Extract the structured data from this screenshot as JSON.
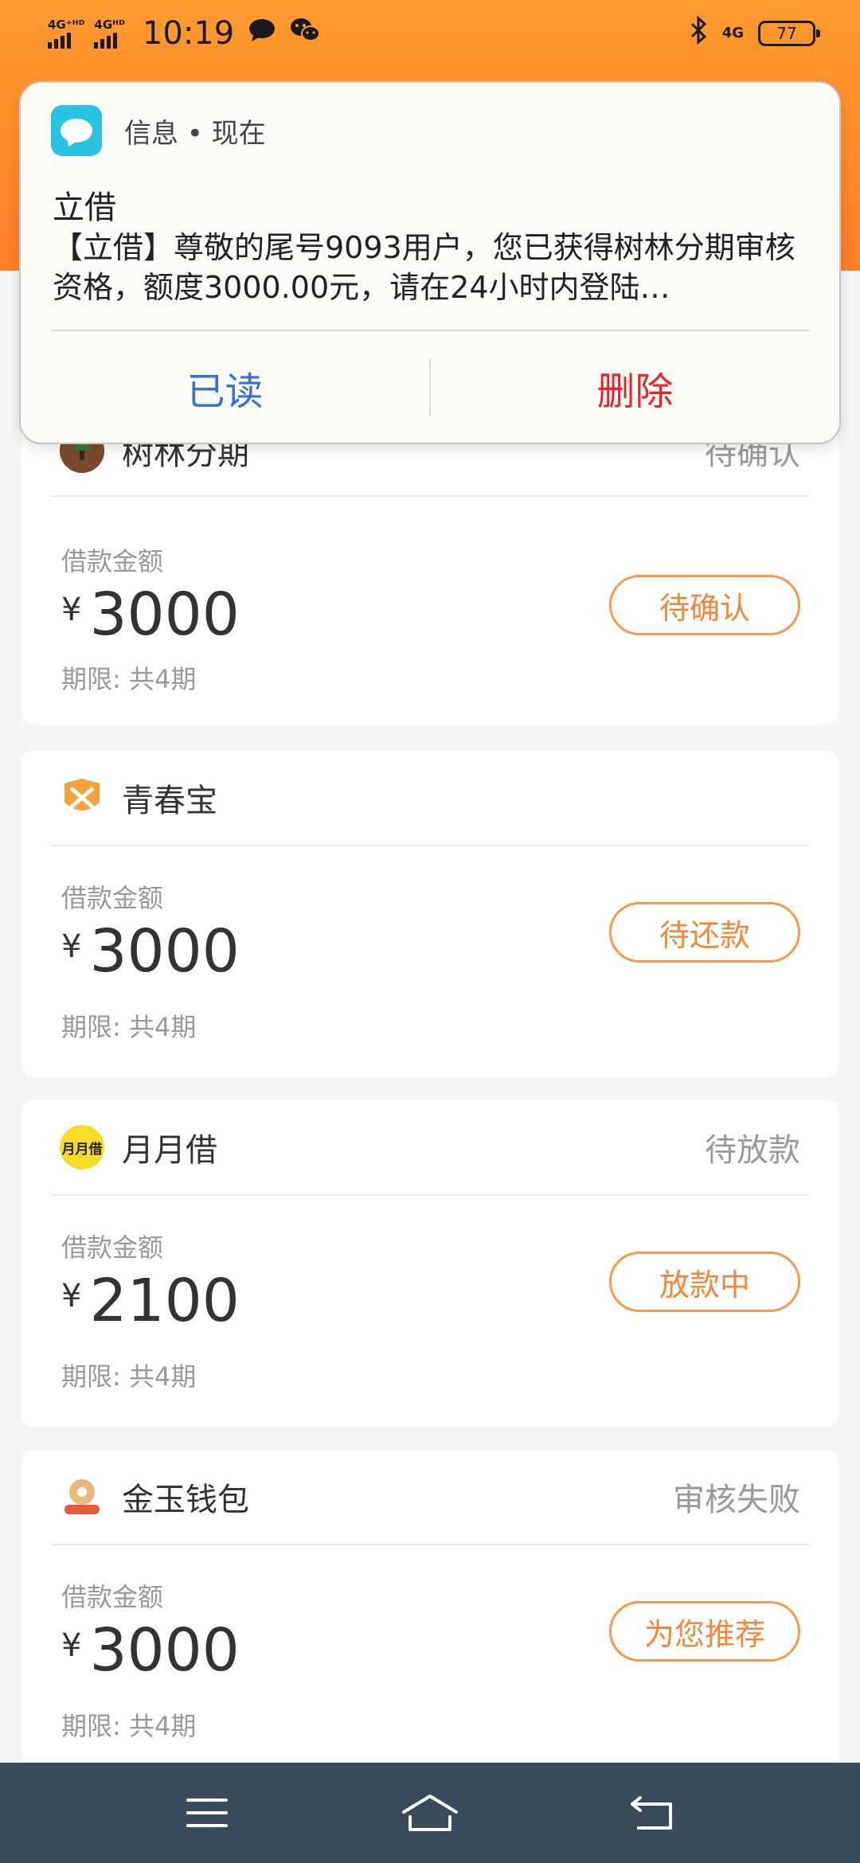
{
  "status_bar": {
    "sim1": "4G⁺ᴴᴰ",
    "sim2": "4Gᴴᴰ",
    "time": "10:19",
    "network_right": "4G",
    "battery": "77"
  },
  "notification": {
    "app_name": "信息 • 现在",
    "title": "立借",
    "body": "【立借】尊敬的尾号9093用户，您已获得树林分期审核资格，额度3000.00元，请在24小时内登陆…",
    "read_label": "已读",
    "delete_label": "删除"
  },
  "loans": [
    {
      "name": "树林分期",
      "status": "待确认",
      "amount_label": "借款金额",
      "currency": "¥",
      "amount": "3000",
      "term": "期限: 共4期",
      "action": "待确认"
    },
    {
      "name": "青春宝",
      "status": "",
      "amount_label": "借款金额",
      "currency": "¥",
      "amount": "3000",
      "term": "期限: 共4期",
      "action": "待还款"
    },
    {
      "name": "月月借",
      "status": "待放款",
      "amount_label": "借款金额",
      "currency": "¥",
      "amount": "2100",
      "term": "期限: 共4期",
      "action": "放款中",
      "logo_text": "月月借"
    },
    {
      "name": "金玉钱包",
      "status": "审核失败",
      "amount_label": "借款金额",
      "currency": "¥",
      "amount": "3000",
      "term": "期限: 共4期",
      "action": "为您推荐"
    }
  ],
  "colors": {
    "header_orange": "#ff8a2a",
    "pill_orange": "#f0873a",
    "read_blue": "#3a6fd8",
    "delete_red": "#e0282e",
    "navbar": "#3b4a5a"
  }
}
